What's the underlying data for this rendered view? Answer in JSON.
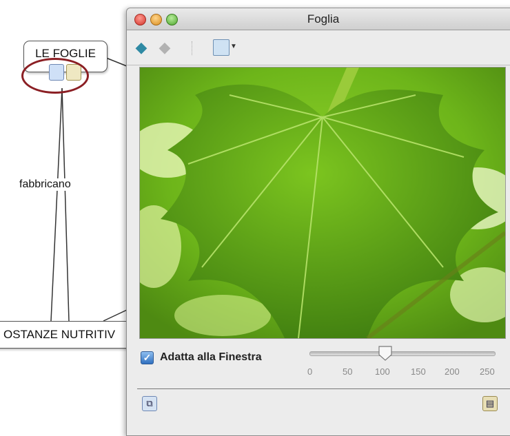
{
  "concept_map": {
    "node_leaves": "LE FOGLIE",
    "node_nutrients": "OSTANZE NUTRITIV",
    "link_label": "fabbricano",
    "resource_icons": [
      "image-resource-icon",
      "document-resource-icon"
    ],
    "highlight_color": "#8b1f24"
  },
  "window": {
    "title": "Foglia",
    "toolbar": {
      "back_icon": "back-arrow-icon",
      "forward_icon": "forward-arrow-icon",
      "view_menu_icon": "view-menu-icon"
    },
    "image_subject": "green leaf photograph",
    "fit_to_window": {
      "label": "Adatta alla Finestra",
      "checked": true
    },
    "zoom": {
      "value": 100,
      "ticks": [
        "0",
        "50",
        "100",
        "150",
        "200",
        "250"
      ]
    },
    "bottom_buttons": [
      "map-view-icon",
      "image-info-icon"
    ]
  }
}
